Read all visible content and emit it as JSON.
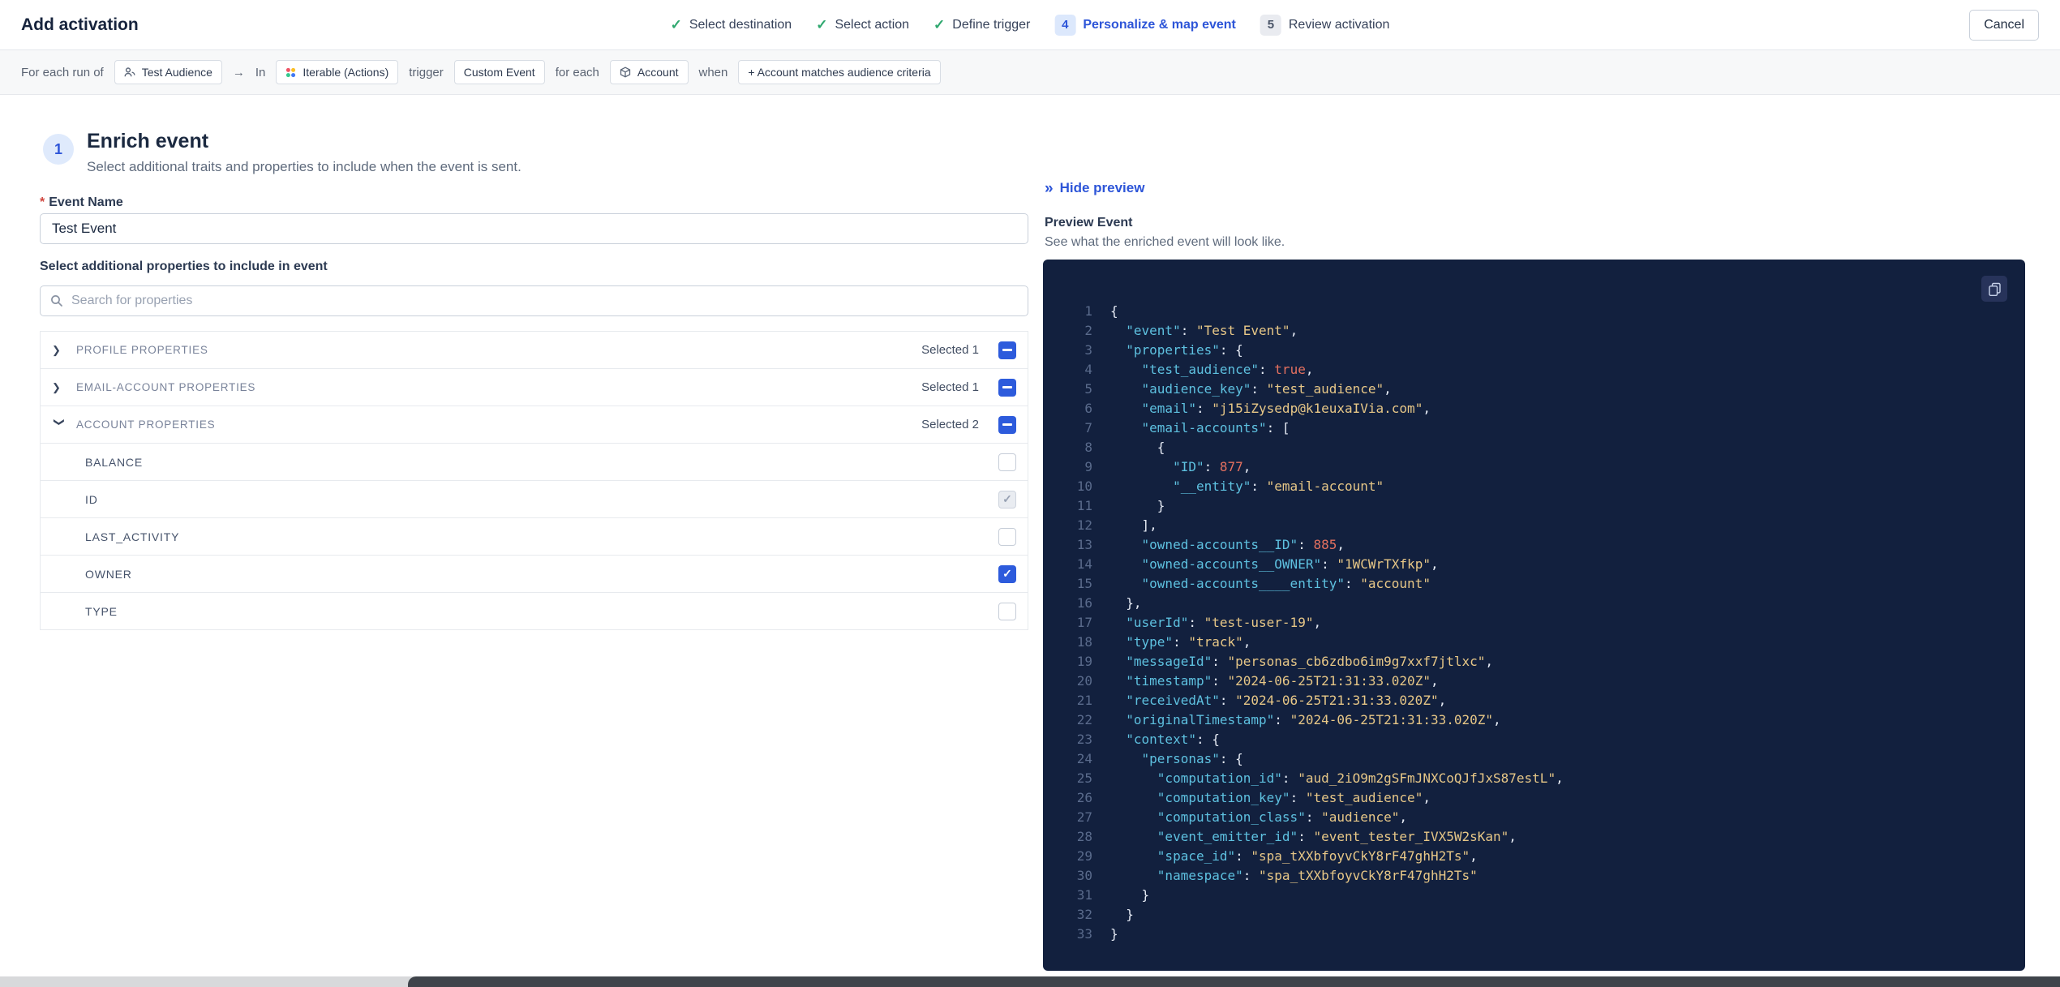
{
  "header": {
    "title": "Add activation",
    "cancel_label": "Cancel",
    "steps": [
      {
        "label": "Select destination",
        "state": "done"
      },
      {
        "label": "Select action",
        "state": "done"
      },
      {
        "label": "Define trigger",
        "state": "done"
      },
      {
        "label": "Personalize & map event",
        "state": "active",
        "num": "4"
      },
      {
        "label": "Review activation",
        "state": "todo",
        "num": "5"
      }
    ]
  },
  "trigger_bar": {
    "segments": [
      {
        "type": "text",
        "text": "For each run of"
      },
      {
        "type": "chip",
        "text": "Test Audience",
        "icon": "audience-icon"
      },
      {
        "type": "text",
        "text": "→"
      },
      {
        "type": "text",
        "text": "In"
      },
      {
        "type": "chip",
        "text": "Iterable (Actions)",
        "icon": "iterable-icon"
      },
      {
        "type": "text",
        "text": "trigger"
      },
      {
        "type": "chip",
        "text": "Custom Event"
      },
      {
        "type": "text",
        "text": "for each"
      },
      {
        "type": "chip",
        "text": "Account",
        "icon": "account-icon"
      },
      {
        "type": "text",
        "text": "when"
      },
      {
        "type": "chip",
        "text": "+ Account matches audience criteria"
      }
    ]
  },
  "enrich": {
    "step_number": "1",
    "title": "Enrich event",
    "subtitle": "Select additional traits and properties to include when the event is sent.",
    "event_name_label": "Event Name",
    "event_name_value": "Test Event",
    "properties_label": "Select additional properties to include in event",
    "search_placeholder": "Search for properties",
    "groups": [
      {
        "label": "PROFILE PROPERTIES",
        "selected_text": "Selected 1",
        "expanded": false,
        "items": []
      },
      {
        "label": "EMAIL-ACCOUNT PROPERTIES",
        "selected_text": "Selected 1",
        "expanded": false,
        "items": []
      },
      {
        "label": "ACCOUNT PROPERTIES",
        "selected_text": "Selected 2",
        "expanded": true,
        "items": [
          {
            "label": "BALANCE",
            "state": "off"
          },
          {
            "label": "ID",
            "state": "disabled-checked"
          },
          {
            "label": "LAST_ACTIVITY",
            "state": "off"
          },
          {
            "label": "OWNER",
            "state": "checked"
          },
          {
            "label": "TYPE",
            "state": "off"
          }
        ]
      }
    ]
  },
  "preview": {
    "hide_label": "Hide preview",
    "title": "Preview Event",
    "subtitle": "See what the enriched event will look like.",
    "colors": {
      "bg": "#12203e",
      "line_number": "#5a6b8c",
      "punct": "#e6ebf5",
      "key": "#5ec1e0",
      "string": "#e7c787",
      "literal": "#e4705f",
      "accent_blue": "#2d55d8",
      "check_green": "#2fa86f"
    },
    "code_lines": [
      "{",
      "  \"event\": \"Test Event\",",
      "  \"properties\": {",
      "    \"test_audience\": true,",
      "    \"audience_key\": \"test_audience\",",
      "    \"email\": \"j15iZysedp@k1euxaIVia.com\",",
      "    \"email-accounts\": [",
      "      {",
      "        \"ID\": 877,",
      "        \"__entity\": \"email-account\"",
      "      }",
      "    ],",
      "    \"owned-accounts__ID\": 885,",
      "    \"owned-accounts__OWNER\": \"1WCWrTXfkp\",",
      "    \"owned-accounts____entity\": \"account\"",
      "  },",
      "  \"userId\": \"test-user-19\",",
      "  \"type\": \"track\",",
      "  \"messageId\": \"personas_cb6zdbo6im9g7xxf7jtlxc\",",
      "  \"timestamp\": \"2024-06-25T21:31:33.020Z\",",
      "  \"receivedAt\": \"2024-06-25T21:31:33.020Z\",",
      "  \"originalTimestamp\": \"2024-06-25T21:31:33.020Z\",",
      "  \"context\": {",
      "    \"personas\": {",
      "      \"computation_id\": \"aud_2iO9m2gSFmJNXCoQJfJxS87estL\",",
      "      \"computation_key\": \"test_audience\",",
      "      \"computation_class\": \"audience\",",
      "      \"event_emitter_id\": \"event_tester_IVX5W2sKan\",",
      "      \"space_id\": \"spa_tXXbfoyvCkY8rF47ghH2Ts\",",
      "      \"namespace\": \"spa_tXXbfoyvCkY8rF47ghH2Ts\"",
      "    }",
      "  }",
      "}"
    ]
  }
}
